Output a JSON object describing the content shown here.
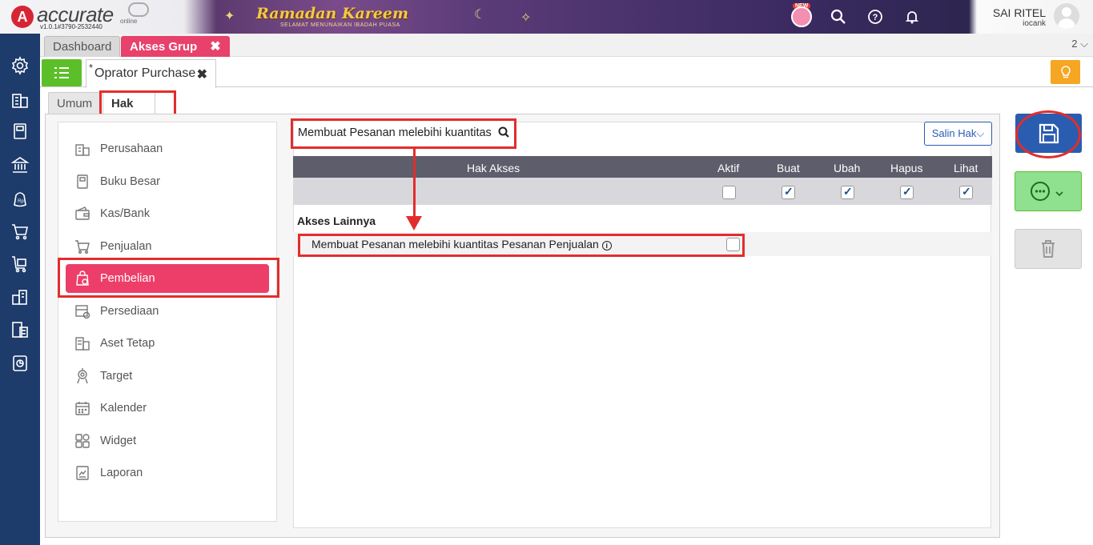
{
  "app": {
    "logo_mark": "A",
    "logo_text": "accurate",
    "logo_online": "online",
    "version": "v1.0.1#3790-2532440",
    "banner_title": "Ramadan Kareem",
    "banner_subtitle": "SELAMAT MENUNAIKAN IBADAH PUASA",
    "new_badge": "NEW",
    "user_name": "SAI RITEL",
    "user_sub": "iocank"
  },
  "tabs": {
    "dashboard": "Dashboard",
    "akses_grup": "Akses Grup",
    "close": "✖",
    "count": "2 ⌵"
  },
  "doc": {
    "star": "*",
    "title": "Oprator Purchase",
    "close": "✖"
  },
  "subtabs": {
    "umum": "Umum",
    "hak_akses": "Hak Akses"
  },
  "menu": {
    "items": [
      {
        "label": "Perusahaan",
        "icon": "building-icon"
      },
      {
        "label": "Buku Besar",
        "icon": "ledger-icon"
      },
      {
        "label": "Kas/Bank",
        "icon": "wallet-icon"
      },
      {
        "label": "Penjualan",
        "icon": "cart-icon"
      },
      {
        "label": "Pembelian",
        "icon": "purchase-bag-icon"
      },
      {
        "label": "Persediaan",
        "icon": "inventory-icon"
      },
      {
        "label": "Aset Tetap",
        "icon": "asset-icon"
      },
      {
        "label": "Target",
        "icon": "target-icon"
      },
      {
        "label": "Kalender",
        "icon": "calendar-icon"
      },
      {
        "label": "Widget",
        "icon": "widget-icon"
      },
      {
        "label": "Laporan",
        "icon": "report-icon"
      }
    ],
    "active_index": 4
  },
  "search": {
    "value": "Membuat Pesanan melebihi kuantitas"
  },
  "salin_label": "Salin Hak⌵",
  "table": {
    "headers": [
      "Hak Akses",
      "Aktif",
      "Buat",
      "Ubah",
      "Hapus",
      "Lihat"
    ],
    "master_checks": [
      false,
      true,
      true,
      true,
      true
    ],
    "group_title": "Akses Lainnya",
    "row_label": "Membuat Pesanan melebihi kuantitas Pesanan Penjualan",
    "row_checked": false
  },
  "colors": {
    "accent_pink": "#ed3e69",
    "sidebar_navy": "#1d3b6b",
    "save_blue": "#2a5db0",
    "highlight_red": "#e32d2d"
  }
}
